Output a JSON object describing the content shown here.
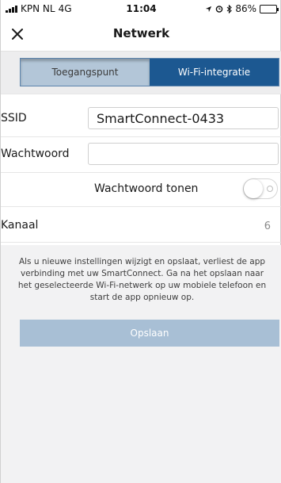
{
  "status_bar": {
    "carrier": "KPN NL",
    "network": "4G",
    "time": "11:04",
    "battery": "86%",
    "battery_level": 0.86
  },
  "nav": {
    "title": "Netwerk",
    "close_icon": "close-icon"
  },
  "segments": {
    "access_point": "Toegangspunt",
    "wifi_integration": "Wi-Fi-integratie",
    "active": "wifi_integration",
    "colors": {
      "active": "#1c5891",
      "inactive": "#b3c6d8"
    }
  },
  "form": {
    "ssid_label": "SSID",
    "ssid_value": "SmartConnect-0433",
    "password_label": "Wachtwoord",
    "password_value": "",
    "show_password_label": "Wachtwoord tonen",
    "show_password_on": false,
    "channel_label": "Kanaal",
    "channel_value": "6"
  },
  "info": {
    "text": "Als u nieuwe instellingen wijzigt en opslaat, verliest de app verbinding met uw SmartConnect. Ga na het opslaan naar het geselecteerde Wi-Fi-netwerk op uw mobiele telefoon en start de app opnieuw op."
  },
  "actions": {
    "save_label": "Opslaan"
  }
}
